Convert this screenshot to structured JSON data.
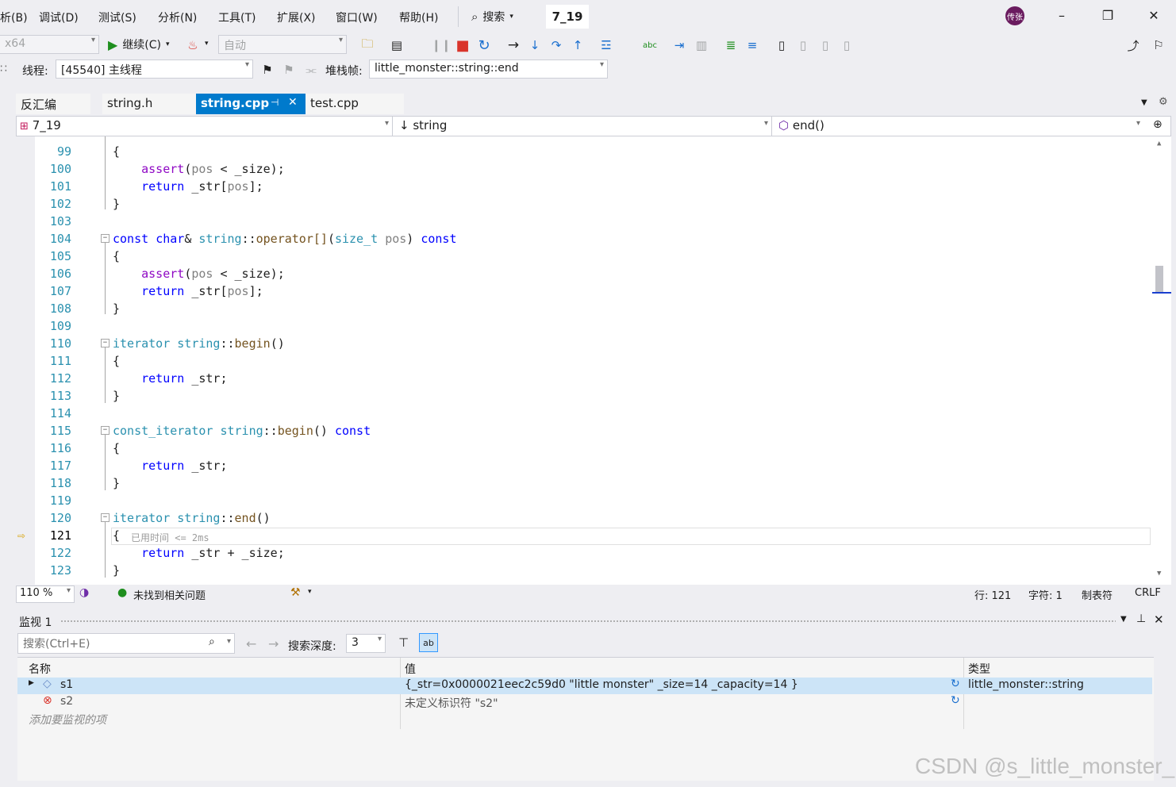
{
  "menubar": {
    "items": [
      "析(B)",
      "调试(D)",
      "测试(S)",
      "分析(N)",
      "工具(T)",
      "扩展(X)",
      "窗口(W)",
      "帮助(H)"
    ],
    "search_label": "搜索",
    "solution_name": "7_19",
    "avatar_text": "传张"
  },
  "toolbar1": {
    "platform": "x64",
    "continue_label": "继续(C)",
    "config": "自动"
  },
  "toolbar2": {
    "thread_label": "线程:",
    "thread_value": "[45540] 主线程",
    "stackframe_label": "堆栈帧:",
    "stackframe_value": "little_monster::string::end"
  },
  "tabs": [
    {
      "label": "反汇编"
    },
    {
      "label": "string.h"
    },
    {
      "label": "string.cpp",
      "active": true
    },
    {
      "label": "test.cpp"
    }
  ],
  "navbar": {
    "project": "7_19",
    "scope": "string",
    "member": "end()"
  },
  "code_lines": [
    {
      "n": "99"
    },
    {
      "n": "100"
    },
    {
      "n": "101"
    },
    {
      "n": "102"
    },
    {
      "n": "103"
    },
    {
      "n": "104"
    },
    {
      "n": "105"
    },
    {
      "n": "106"
    },
    {
      "n": "107"
    },
    {
      "n": "108"
    },
    {
      "n": "109"
    },
    {
      "n": "110"
    },
    {
      "n": "111"
    },
    {
      "n": "112"
    },
    {
      "n": "113"
    },
    {
      "n": "114"
    },
    {
      "n": "115"
    },
    {
      "n": "116"
    },
    {
      "n": "117"
    },
    {
      "n": "118"
    },
    {
      "n": "119"
    },
    {
      "n": "120"
    },
    {
      "n": "121"
    },
    {
      "n": "122"
    },
    {
      "n": "123"
    }
  ],
  "perf_tip": "已用时间 <= 2ms",
  "editor_status": {
    "zoom": "110 %",
    "issues": "未找到相关问题",
    "line": "行: 121",
    "col": "字符: 1",
    "tabs": "制表符",
    "eol": "CRLF"
  },
  "watch": {
    "title": "监视 1",
    "search_placeholder": "搜索(Ctrl+E)",
    "depth_label": "搜索深度:",
    "depth_value": "3",
    "columns": {
      "name": "名称",
      "value": "值",
      "type": "类型"
    },
    "rows": [
      {
        "name": "s1",
        "value": "{_str=0x0000021eec2c59d0 \"little monster\" _size=14 _capacity=14 }",
        "type": "little_monster::string"
      },
      {
        "name": "s2",
        "value": "未定义标识符 \"s2\"",
        "type": ""
      }
    ],
    "add_placeholder": "添加要监视的项"
  },
  "watermark": "CSDN @s_little_monster_",
  "colors": {
    "accent": "#007acc",
    "keyword": "#0000ff",
    "type": "#2b91af",
    "macro": "#8f08c4",
    "selected_row": "#cce4f7"
  }
}
